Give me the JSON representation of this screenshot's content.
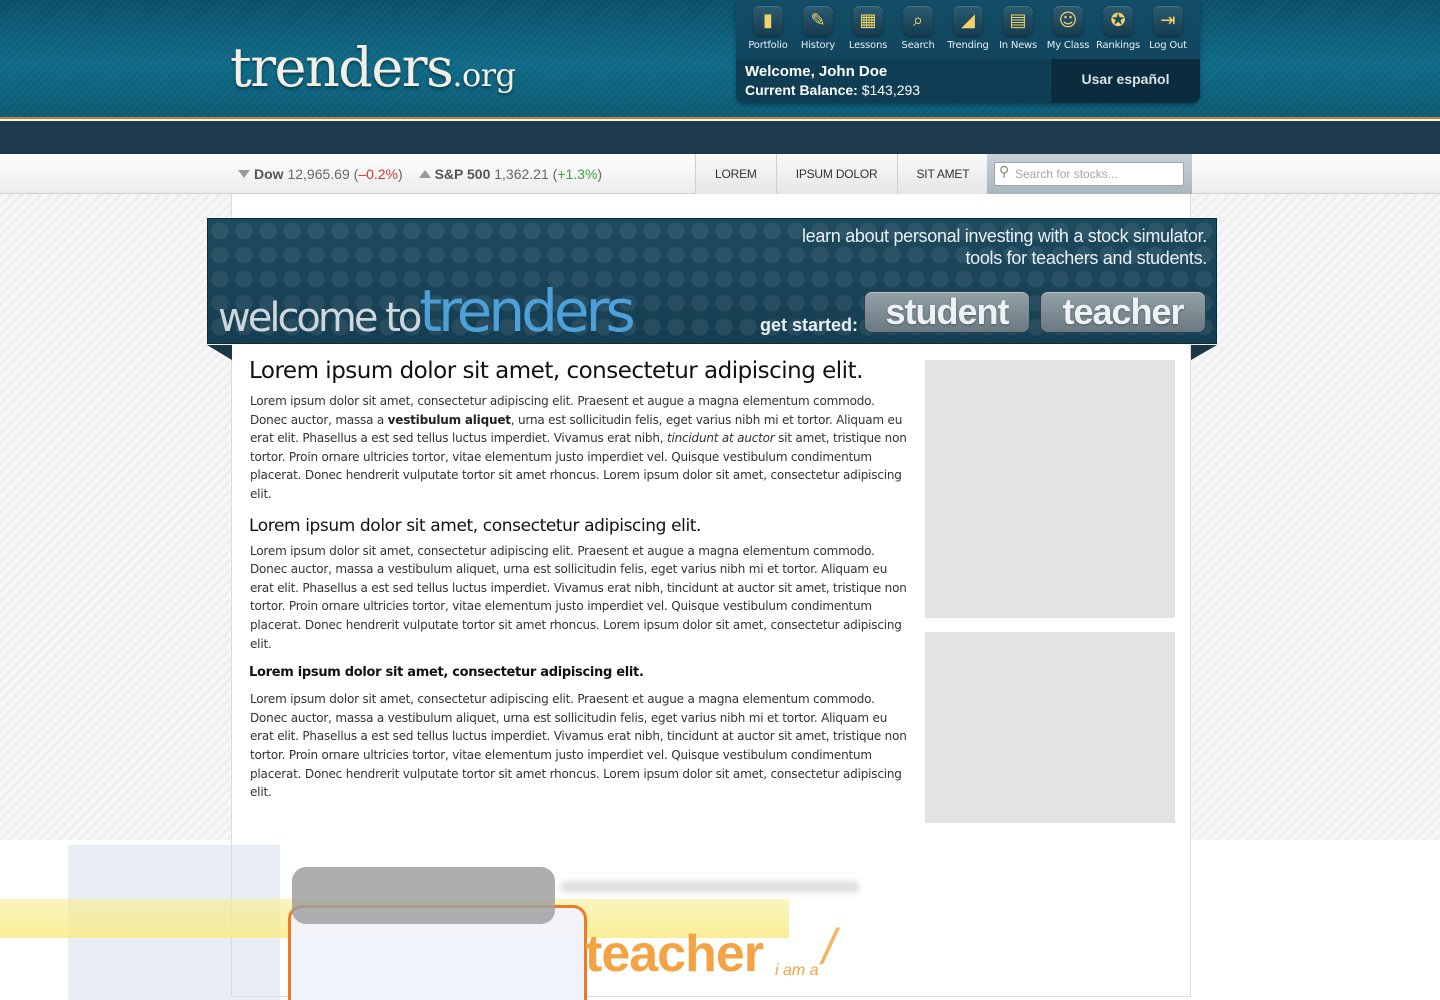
{
  "header": {
    "logo_main": "trenders",
    "logo_tld": ".org",
    "nav": [
      {
        "label": "Portfolio",
        "icon": "portfolio-icon",
        "glyph": "▮"
      },
      {
        "label": "History",
        "icon": "history-icon",
        "glyph": "✎"
      },
      {
        "label": "Lessons",
        "icon": "lessons-icon",
        "glyph": "▦"
      },
      {
        "label": "Search",
        "icon": "search-icon",
        "glyph": "⌕"
      },
      {
        "label": "Trending",
        "icon": "trending-icon",
        "glyph": "◢"
      },
      {
        "label": "In News",
        "icon": "news-icon",
        "glyph": "▤"
      },
      {
        "label": "My Class",
        "icon": "my-class-icon",
        "glyph": "☺"
      },
      {
        "label": "Rankings",
        "icon": "rankings-icon",
        "glyph": "✪"
      },
      {
        "label": "Log Out",
        "icon": "log-out-icon",
        "glyph": "⇥"
      }
    ],
    "welcome": "Welcome, John Doe",
    "balance_label": "Current Balance:",
    "balance_value": "$143,293",
    "language_button": "Usar español"
  },
  "ticker": {
    "dow": {
      "name": "Dow",
      "value": "12,965.69",
      "change": "–0.2%"
    },
    "sp500": {
      "name": "S&P 500",
      "value": "1,362.21",
      "change": "+1.3%"
    }
  },
  "tabs": [
    "Lorem",
    "Ipsum Dolor",
    "Sit Amet"
  ],
  "search": {
    "placeholder": "Search for stocks..."
  },
  "banner": {
    "tagline_1": "learn about personal investing with a stock simulator.",
    "tagline_2": "tools for teachers and students.",
    "welcome_prefix": "welcome to",
    "welcome_brand": "trenders",
    "get_started": "get started:",
    "student_button": "student",
    "teacher_button": "teacher"
  },
  "article": {
    "h1": "Lorem ipsum dolor sit amet, consectetur adipiscing elit.",
    "p1_a": "Lorem ipsum dolor sit amet, consectetur adipiscing elit. Praesent et augue a magna elementum commodo. Donec auctor, massa a ",
    "p1_bold": "vestibulum aliquet",
    "p1_b": ", urna est sollicitudin felis, eget varius nibh mi et tortor. Aliquam eu erat elit. Phasellus a est sed tellus luctus imperdiet. Vivamus erat nibh, ",
    "p1_italic": "tincidunt at auctor",
    "p1_c": " sit amet, tristique non tortor. Proin ornare ultricies tortor, vitae elementum justo imperdiet vel. Quisque vestibulum condimentum placerat. Donec hendrerit vulputate tortor sit amet rhoncus. Lorem ipsum dolor sit amet, consectetur adipiscing elit.",
    "h2": "Lorem ipsum dolor sit amet, consectetur adipiscing elit.",
    "p2": "Lorem ipsum dolor sit amet, consectetur adipiscing elit. Praesent et augue a magna elementum commodo. Donec auctor, massa a vestibulum aliquet, urna est sollicitudin felis, eget varius nibh mi et tortor. Aliquam eu erat elit. Phasellus a est sed tellus luctus imperdiet. Vivamus erat nibh, tincidunt at auctor sit amet, tristique non tortor. Proin ornare ultricies tortor, vitae elementum justo imperdiet vel. Quisque vestibulum condimentum placerat. Donec hendrerit vulputate tortor sit amet rhoncus. Lorem ipsum dolor sit amet, consectetur adipiscing elit.",
    "h3": "Lorem ipsum dolor sit amet, consectetur adipiscing elit.",
    "p3": "Lorem ipsum dolor sit amet, consectetur adipiscing elit. Praesent et augue a magna elementum commodo. Donec auctor, massa a vestibulum aliquet, urna est sollicitudin felis, eget varius nibh mi et tortor. Aliquam eu erat elit. Phasellus a est sed tellus luctus imperdiet. Vivamus erat nibh, tincidunt at auctor sit amet, tristique non tortor. Proin ornare ultricies tortor, vitae elementum justo imperdiet vel. Quisque vestibulum condimentum placerat. Donec hendrerit vulputate tortor sit amet rhoncus. Lorem ipsum dolor sit amet, consectetur adipiscing elit."
  },
  "overlay": {
    "teacher_text": "teacher",
    "iama_text": "i am a",
    "slash": "/"
  },
  "colors": {
    "header_teal": "#0f6a86",
    "gold_rule": "#b9862f",
    "negative": "#d0392b",
    "positive": "#3ca33c",
    "brand_blue": "#4da0d8",
    "overlay_orange": "#f4a343"
  }
}
